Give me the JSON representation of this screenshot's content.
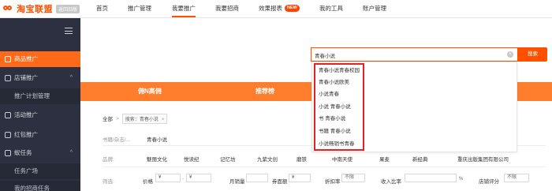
{
  "app": {
    "logo_text": "淘宝联盟",
    "logo_badge": "返回旧版"
  },
  "topnav": {
    "items": [
      "首页",
      "推广管理",
      "我要推广",
      "我要招商",
      "效果报表",
      "我的工具",
      "账户管理"
    ],
    "new_badge": "NEW",
    "active_index": 2
  },
  "sidebar": {
    "items": [
      {
        "label": "商品推广",
        "active": true
      },
      {
        "label": "店铺推广",
        "chevron": "^"
      },
      {
        "label": "推广计划管理",
        "sub": true
      },
      {
        "label": "活动推广"
      },
      {
        "label": "红包推广"
      },
      {
        "label": "蚁任务",
        "chevron": "^"
      },
      {
        "label": "任务广场",
        "sub": true
      },
      {
        "label": "我的招商任务",
        "sub": true
      }
    ]
  },
  "search": {
    "value": "青春小说",
    "button_label": "搜索",
    "suggestions": [
      "青春小说青春校园",
      "青春小说欧美",
      "小说青春",
      "小说 青春小说",
      "书 青春小说",
      "书籍 青春小说",
      "小说畅销书青春"
    ]
  },
  "banner": {
    "tabs": [
      "佣N高佣",
      "推荐榜"
    ]
  },
  "breadcrumb": {
    "all_label": "全部",
    "separator": ">",
    "tag_prefix": "搜索：",
    "tag_value": "青春小说",
    "tag_close": "×"
  },
  "filters": {
    "category_label": "书籍/杂志/...",
    "category_value": "青春小说",
    "brand_label": "品牌:",
    "brands": [
      "魅丽文化",
      "悦读纪",
      "记忆坊",
      "九紫文创",
      "磨铁",
      "中南天使",
      "果麦",
      "新经典",
      "重庆出版集团有限公司"
    ],
    "screen_label": "筛选:",
    "price_label": "价格",
    "price_from": "¥",
    "price_to": "¥",
    "monthly_sales_label": "月销量",
    "coupon_label": "券面额",
    "coupon_placeholder": "¥",
    "discount_label": "折扣率",
    "discount_value": "不限",
    "income_label": "收入比率",
    "income_unit": "%",
    "rating_label": "店铺评分",
    "rating_value": "不限"
  },
  "colors": {
    "accent": "#ff5000",
    "banner": "#ff7e2e",
    "sidebar_bg": "#2d3040",
    "highlight": "#e52222"
  }
}
